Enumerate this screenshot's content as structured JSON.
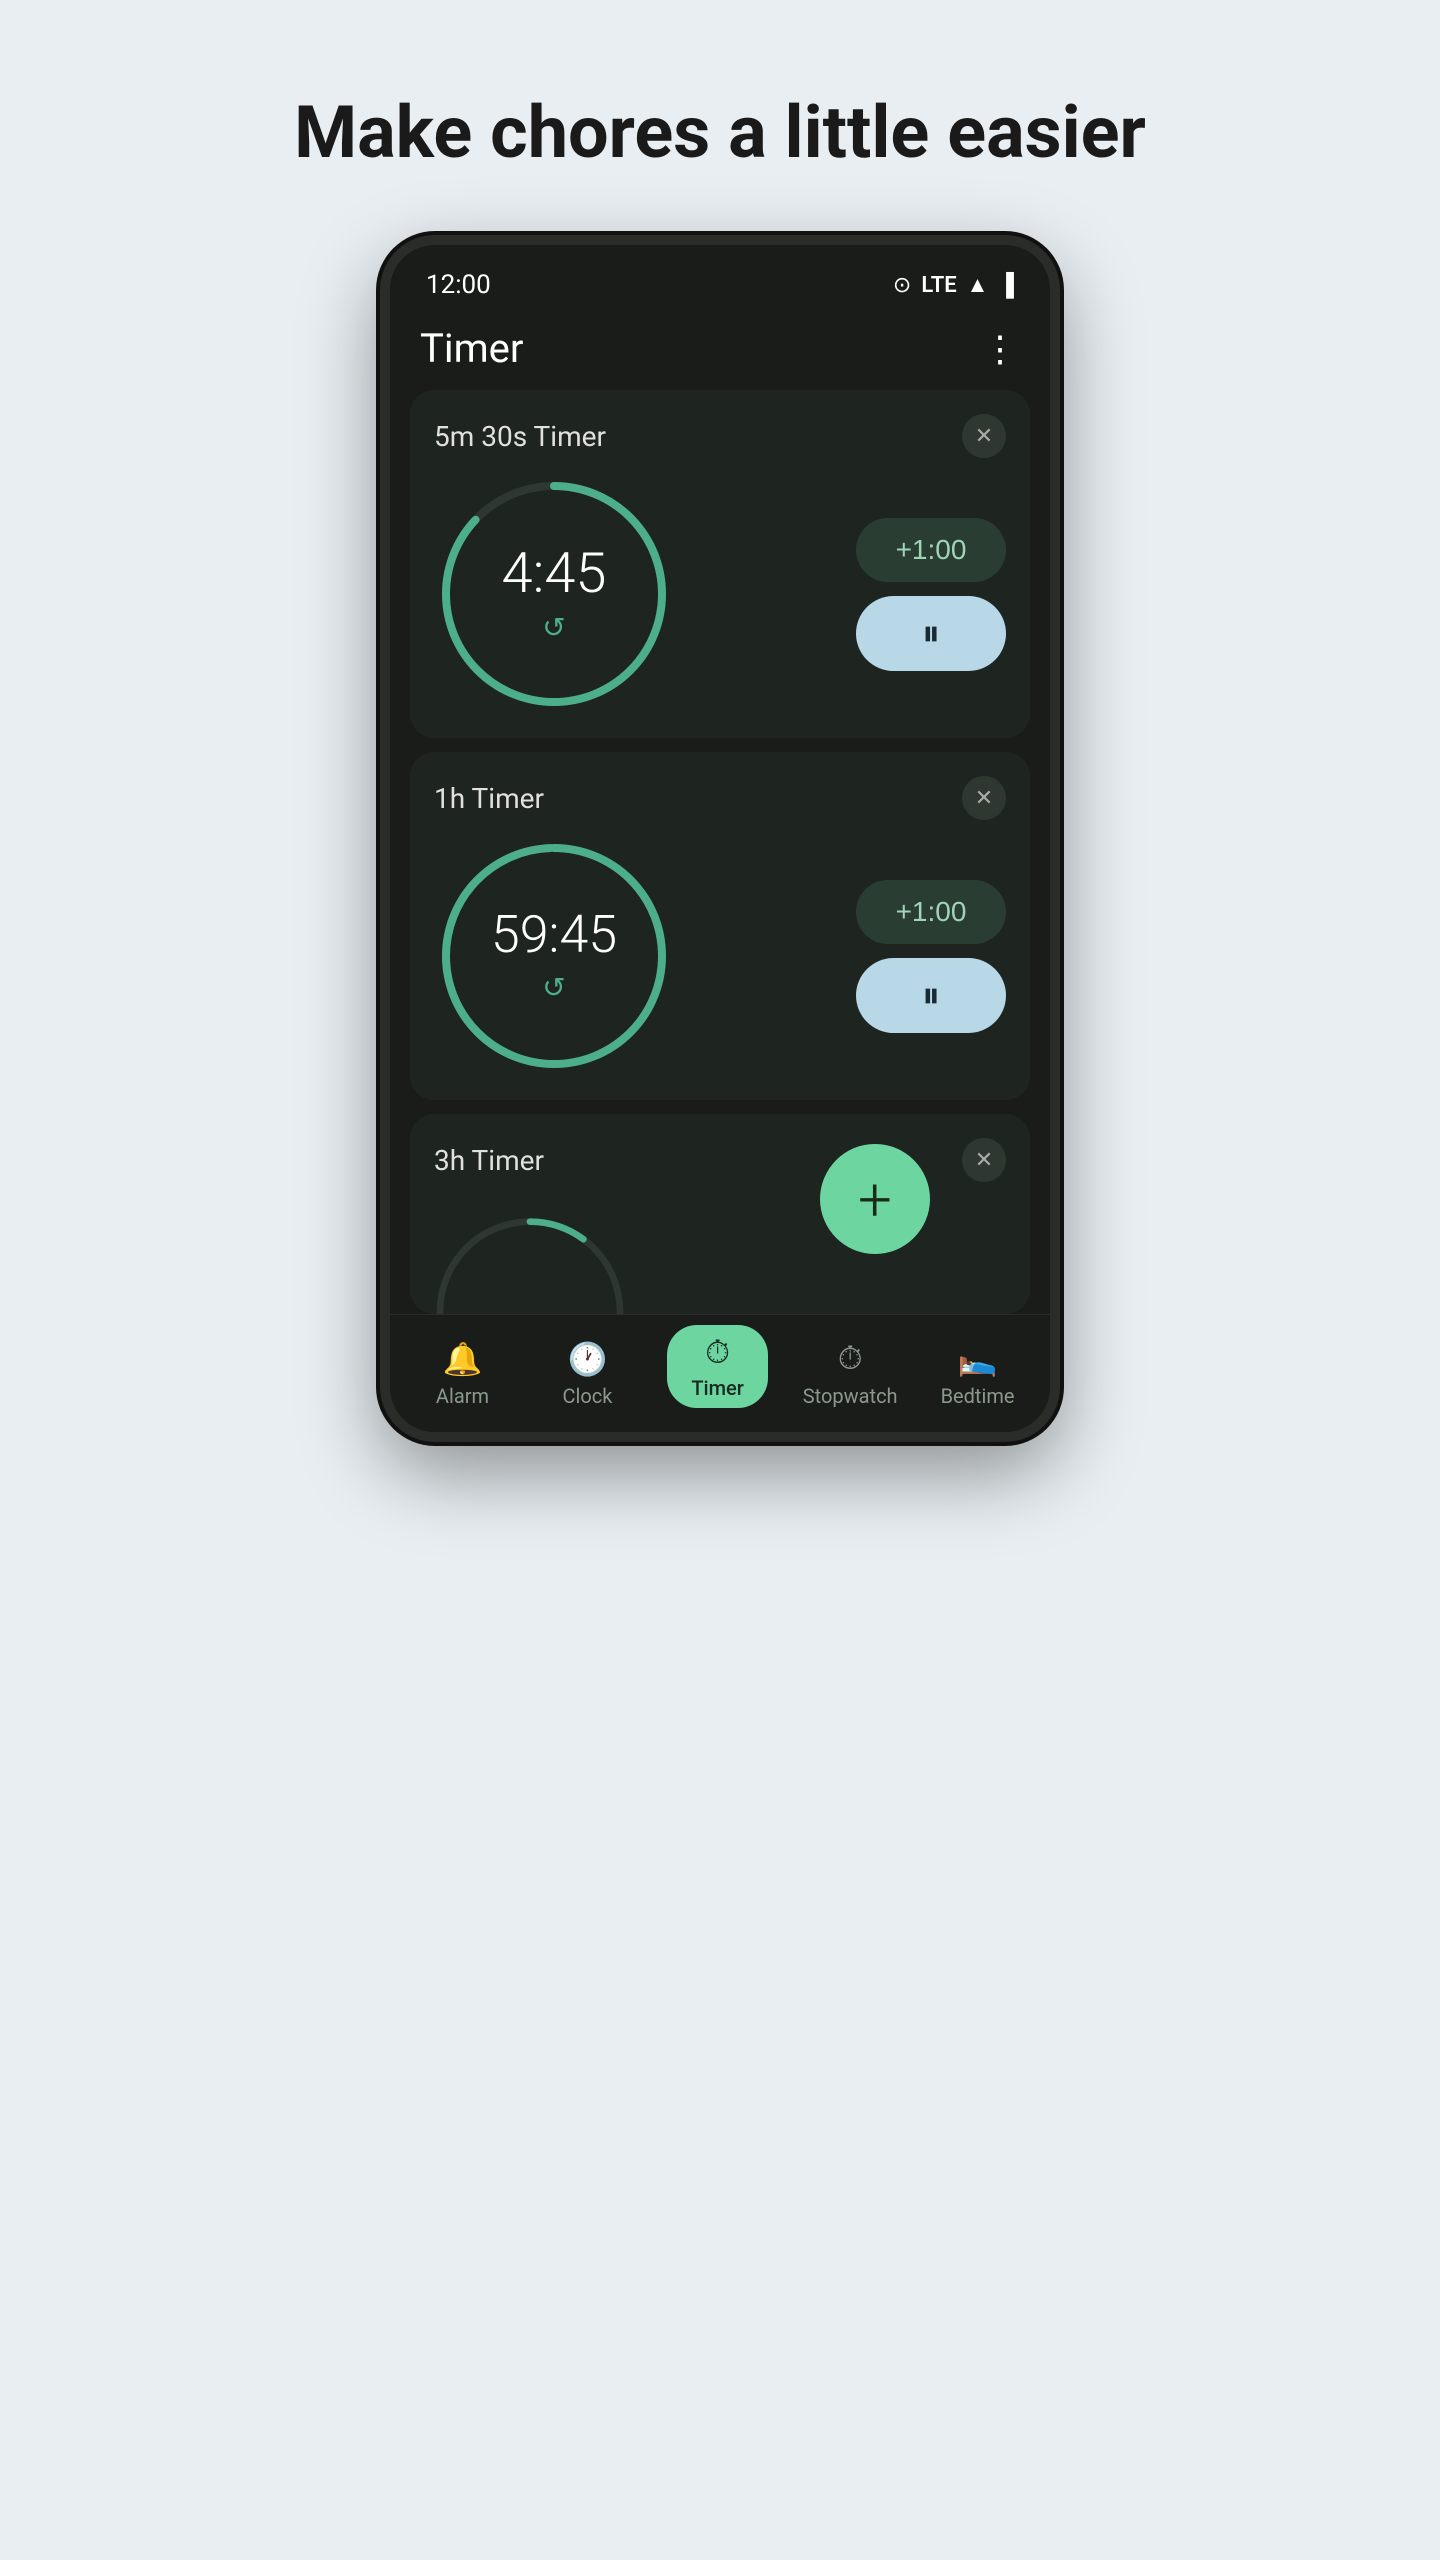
{
  "page": {
    "tagline": "Make chores a little easier"
  },
  "statusBar": {
    "time": "12:00",
    "wifi": "▼",
    "lte": "LTE",
    "signal": "▲",
    "battery": "🔋"
  },
  "appHeader": {
    "title": "Timer",
    "moreMenuLabel": "⋮"
  },
  "timers": [
    {
      "label": "5m 30s Timer",
      "time": "4:45",
      "progress": 0.87,
      "addLabel": "+1:00",
      "pauseIcon": "⏸"
    },
    {
      "label": "1h Timer",
      "time": "59:45",
      "progress": 0.995,
      "addLabel": "+1:00",
      "pauseIcon": "⏸"
    },
    {
      "label": "3h Timer",
      "time": "",
      "progress": 0.1,
      "addLabel": "+",
      "pauseIcon": "⏸"
    }
  ],
  "bottomNav": [
    {
      "id": "alarm",
      "label": "Alarm",
      "icon": "🔔",
      "active": false
    },
    {
      "id": "clock",
      "label": "Clock",
      "icon": "🕐",
      "active": false
    },
    {
      "id": "timer",
      "label": "Timer",
      "icon": "⏱",
      "active": true
    },
    {
      "id": "stopwatch",
      "label": "Stopwatch",
      "icon": "⏱",
      "active": false
    },
    {
      "id": "bedtime",
      "label": "Bedtime",
      "icon": "🛌",
      "active": false
    }
  ]
}
